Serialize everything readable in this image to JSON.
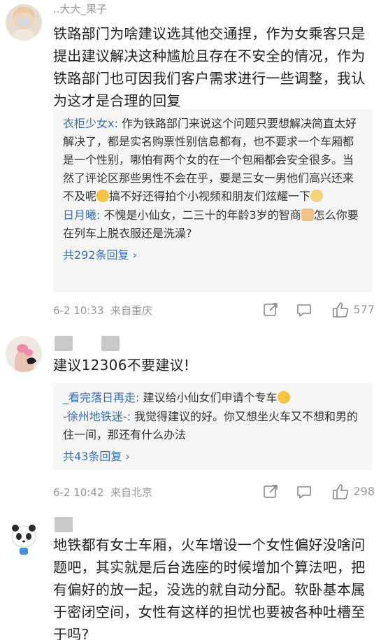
{
  "comments": [
    {
      "username": "..大大_果子",
      "body": "铁路部门为啥建议选其他交通捏，作为女乘客只是提出建议解决这种尴尬且存在不安全的情况，作为铁路部门也可因我们客户需求进行一些调整，我认为这才是合理的回复",
      "replies": [
        {
          "name": "衣柜少女x",
          "text": "作为铁路部门来说这个问题只要想解决简直太好解决了，都是实名购票性别信息都有，也不要求一个车厢都是一个性别，哪怕有两个女的在一个包厢都会安全很多。当然了评论区那些男性不会在乎，要是三女一男他们高兴还来不及呢",
          "text_after_emoji": "搞不好还得拍个小视频和朋友们炫耀一下"
        },
        {
          "name": "日月曦",
          "text": "不愧是小仙女，二三十的年龄3岁的智商",
          "text_after_emoji": "怎么你要在列车上脱衣服还是洗澡?"
        }
      ],
      "more_replies": "共292条回复",
      "timestamp": "6-2 10:33",
      "location": "来自重庆",
      "likes": "577"
    },
    {
      "username": "",
      "body": "建议12306不要建议!",
      "replies": [
        {
          "name": "_看完落日再走",
          "text": "建议给小仙女们申请个专车"
        },
        {
          "name": "-徐州地铁迷-",
          "text": "我觉得建议的好。你又想坐火车又不想和男的住一间，那还有什么办法"
        }
      ],
      "more_replies": "共43条回复",
      "timestamp": "6-2 10:42",
      "location": "来自北京",
      "likes": "298"
    },
    {
      "username": "",
      "body": "地铁都有女士车厢，火车增设一个女性偏好没啥问题吧，其实就是后台选座的时候增加个算法吧，把有偏好的放一起，没选的就自动分配。软卧基本属于密闭空间，女性有这样的担忧也要被各种吐槽至于吗?"
    }
  ],
  "colors": {
    "link": "#3a6fb0",
    "meta": "#999999",
    "reply_bg": "#f6f6f6"
  },
  "icons": [
    "share-icon",
    "comment-icon",
    "like-icon"
  ]
}
